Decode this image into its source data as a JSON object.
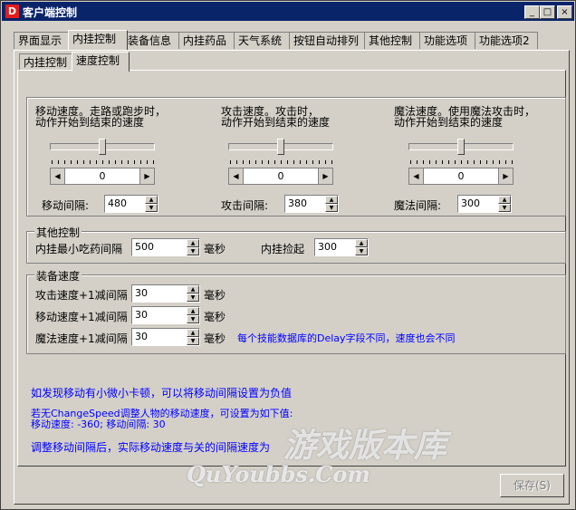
{
  "window": {
    "title": "客户端控制",
    "icon_letter": "D"
  },
  "titlebar_buttons": {
    "min": "_",
    "max": "□",
    "close": "×"
  },
  "main_tabs": [
    "界面显示",
    "内挂控制",
    "装备信息",
    "内挂药品",
    "天气系统",
    "按钮自动排列",
    "其他控制",
    "功能选项",
    "功能选项2"
  ],
  "sub_tabs": [
    "内挂控制",
    "速度控制"
  ],
  "speed": {
    "move": {
      "label_line1": "移动速度。走路或跑步时，",
      "label_line2": "动作开始到结束的速度",
      "scroll_value": "0",
      "interval_label": "移动间隔:",
      "interval_value": "480"
    },
    "attack": {
      "label_line1": "攻击速度。攻击时，",
      "label_line2": "动作开始到结束的速度",
      "scroll_value": "0",
      "interval_label": "攻击间隔:",
      "interval_value": "380"
    },
    "magic": {
      "label_line1": "魔法速度。使用魔法攻击时，",
      "label_line2": "动作开始到结束的速度",
      "scroll_value": "0",
      "interval_label": "魔法间隔:",
      "interval_value": "300"
    }
  },
  "other": {
    "title": "其他控制",
    "min_drink_label": "内挂最小吃药间隔",
    "min_drink_value": "500",
    "min_drink_unit": "毫秒",
    "pickup_label": "内挂捡起",
    "pickup_value": "300"
  },
  "equip": {
    "title": "装备速度",
    "rows": [
      {
        "label": "攻击速度+1减间隔",
        "value": "30",
        "unit": "毫秒"
      },
      {
        "label": "移动速度+1减间隔",
        "value": "30",
        "unit": "毫秒"
      },
      {
        "label": "魔法速度+1减间隔",
        "value": "30",
        "unit": "毫秒"
      }
    ],
    "note": "每个技能数据库的Delay字段不同，速度也会不同"
  },
  "notes": {
    "line1": "如发现移动有小微小卡顿，可以将移动间隔设置为负值",
    "line2": "若无ChangeSpeed调整人物的移动速度，可设置为如下值:",
    "line3": "移动速度: -360; 移动间隔: 30",
    "line4": "调整移动间隔后，实际移动速度与关的间隔速度为"
  },
  "save_button": "保存(S)",
  "watermark": {
    "cn": "游戏版本库",
    "en": "QuYoubbs.Com"
  }
}
